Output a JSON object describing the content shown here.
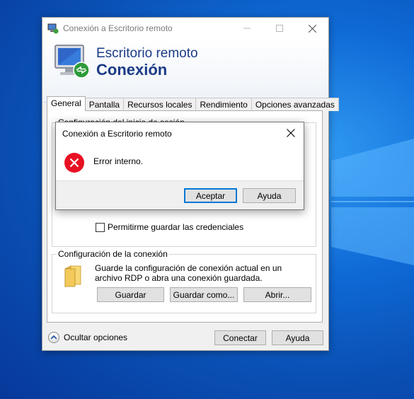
{
  "main_window": {
    "title": "Conexión a Escritorio remoto",
    "banner": {
      "line1": "Escritorio remoto",
      "line2": "Conexión"
    },
    "tabs": [
      {
        "label": "General",
        "active": true
      },
      {
        "label": "Pantalla",
        "active": false
      },
      {
        "label": "Recursos locales",
        "active": false
      },
      {
        "label": "Rendimiento",
        "active": false
      },
      {
        "label": "Opciones avanzadas",
        "active": false
      }
    ],
    "login_group": {
      "label": "Configuración del inicio de sesión",
      "save_credentials": {
        "label": "Permitirme guardar las credenciales",
        "checked": false
      }
    },
    "connection_group": {
      "label": "Configuración de la conexión",
      "description": "Guarde la configuración de conexión actual en un archivo RDP o abra una conexión guardada.",
      "save": "Guardar",
      "save_as": "Guardar como...",
      "open": "Abrir..."
    },
    "footer": {
      "hide_options": "Ocultar opciones",
      "connect": "Conectar",
      "help": "Ayuda"
    }
  },
  "error_dialog": {
    "title": "Conexión a Escritorio remoto",
    "message": "Error interno.",
    "accept": "Aceptar",
    "help": "Ayuda"
  },
  "colors": {
    "desktop": "#0a5fc9",
    "accent": "#0078d7",
    "error": "#e81123",
    "banner_text": "#1b3b86"
  },
  "icons": [
    "remote-desktop-icon",
    "minimize-icon",
    "maximize-icon",
    "close-icon",
    "monitor-logo-icon",
    "folder-icon",
    "chevron-up-icon",
    "error-icon"
  ]
}
